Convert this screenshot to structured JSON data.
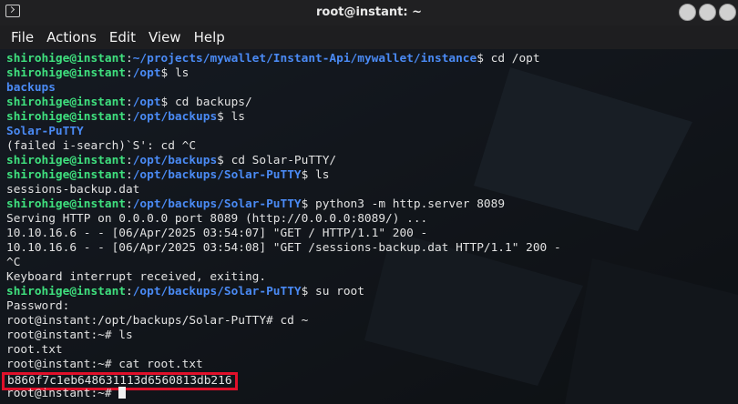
{
  "window": {
    "title": "root@instant: ~"
  },
  "menu": [
    "File",
    "Actions",
    "Edit",
    "View",
    "Help"
  ],
  "colors": {
    "user": "#3fe07e",
    "path": "#4a8af4",
    "highlight": "#e0102a"
  },
  "terminal": {
    "lines": [
      {
        "user": "shirohige@instant",
        "path": "~/projects/mywallet/Instant-Api/mywallet/instance",
        "cmd": "$ cd /opt"
      },
      {
        "user": "shirohige@instant",
        "path": "/opt",
        "cmd": "$ ls"
      },
      {
        "blue": "backups"
      },
      {
        "user": "shirohige@instant",
        "path": "/opt",
        "cmd": "$ cd backups/"
      },
      {
        "user": "shirohige@instant",
        "path": "/opt/backups",
        "cmd": "$ ls"
      },
      {
        "blue": "Solar-PuTTY"
      },
      {
        "text": "(failed i-search)`S': cd ^C"
      },
      {
        "user": "shirohige@instant",
        "path": "/opt/backups",
        "cmd": "$ cd Solar-PuTTY/"
      },
      {
        "user": "shirohige@instant",
        "path": "/opt/backups/Solar-PuTTY",
        "cmd": "$ ls"
      },
      {
        "text": "sessions-backup.dat"
      },
      {
        "user": "shirohige@instant",
        "path": "/opt/backups/Solar-PuTTY",
        "cmd": "$ python3 -m http.server 8089"
      },
      {
        "text": "Serving HTTP on 0.0.0.0 port 8089 (http://0.0.0.0:8089/) ..."
      },
      {
        "text": "10.10.16.6 - - [06/Apr/2025 03:54:07] \"GET / HTTP/1.1\" 200 -"
      },
      {
        "text": "10.10.16.6 - - [06/Apr/2025 03:54:08] \"GET /sessions-backup.dat HTTP/1.1\" 200 -"
      },
      {
        "text": "^C"
      },
      {
        "text": "Keyboard interrupt received, exiting."
      },
      {
        "user": "shirohige@instant",
        "path": "/opt/backups/Solar-PuTTY",
        "cmd": "$ su root"
      },
      {
        "text": "Password:"
      },
      {
        "text": "root@instant:/opt/backups/Solar-PuTTY# cd ~"
      },
      {
        "text": "root@instant:~# ls"
      },
      {
        "text": "root.txt"
      },
      {
        "text": "root@instant:~# cat root.txt"
      },
      {
        "flag": "b860f7c1eb648631113d6560813db216"
      },
      {
        "prompt": "root@instant:~# ",
        "cursor": true
      }
    ]
  }
}
